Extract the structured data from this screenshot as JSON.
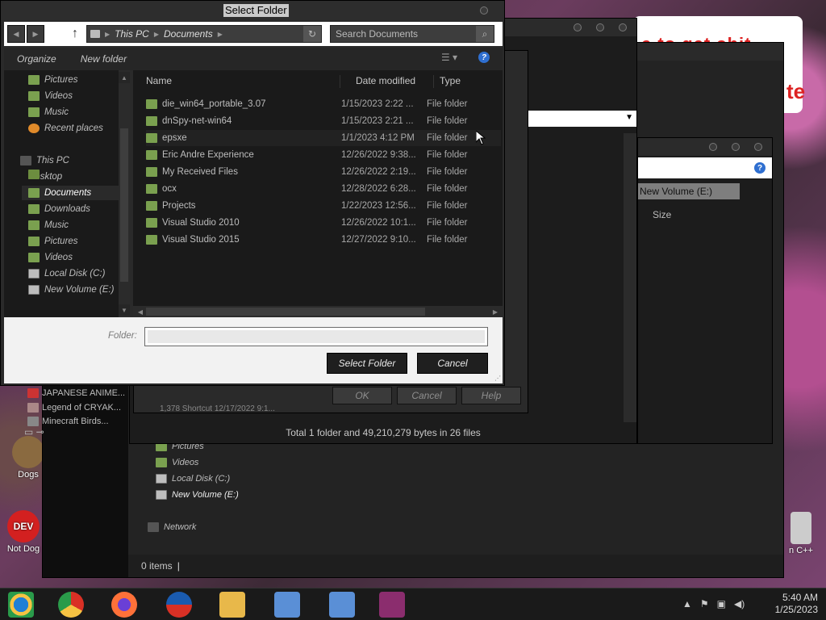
{
  "desktop": {
    "icons": [
      {
        "label": "Dogs"
      },
      {
        "label": "Not Dog"
      },
      {
        "label": "n C++"
      }
    ],
    "red_text_1": "e to get shit",
    "red_text_2": "te"
  },
  "back_window": {
    "nav_items": [
      {
        "label": "Pictures",
        "icon": "folder-icon"
      },
      {
        "label": "Videos",
        "icon": "folder-icon"
      },
      {
        "label": "Local Disk (C:)",
        "icon": "drive-icon"
      },
      {
        "label": "New Volume (E:)",
        "icon": "drive-icon"
      },
      {
        "label": "Network",
        "icon": "network-icon"
      }
    ],
    "status": "0 items"
  },
  "mid_window": {
    "status": "Total 1 folder and 49,210,279 bytes in 26 files",
    "left_items": [
      "JAPANESE ANIME...",
      "Legend of CRYAK...",
      "Minecraft Birds..."
    ],
    "row_fragment": "1,378    Shortcut        12/17/2022 9:1..."
  },
  "right_window": {
    "volume": "New Volume (E:)",
    "size_header": "Size"
  },
  "dialog2": {
    "buttons": [
      "OK",
      "Cancel",
      "Help"
    ]
  },
  "select_folder": {
    "title": "Select Folder",
    "breadcrumb": [
      "This PC",
      "Documents"
    ],
    "search_placeholder": "Search Documents",
    "toolbar": {
      "organize": "Organize",
      "new_folder": "New folder"
    },
    "nav": [
      {
        "label": "Pictures",
        "icon": "folder"
      },
      {
        "label": "Videos",
        "icon": "folder"
      },
      {
        "label": "Music",
        "icon": "folder"
      },
      {
        "label": "Recent places",
        "icon": "recent"
      },
      {
        "label": "This PC",
        "icon": "pc"
      },
      {
        "label": "Desktop",
        "icon": "desktop"
      },
      {
        "label": "Documents",
        "icon": "folder",
        "selected": true
      },
      {
        "label": "Downloads",
        "icon": "folder"
      },
      {
        "label": "Music",
        "icon": "folder"
      },
      {
        "label": "Pictures",
        "icon": "folder"
      },
      {
        "label": "Videos",
        "icon": "folder"
      },
      {
        "label": "Local Disk (C:)",
        "icon": "drive"
      },
      {
        "label": "New Volume (E:)",
        "icon": "drive"
      }
    ],
    "columns": {
      "name": "Name",
      "date": "Date modified",
      "type": "Type"
    },
    "files": [
      {
        "name": "die_win64_portable_3.07",
        "date": "1/15/2023 2:22 ...",
        "type": "File folder"
      },
      {
        "name": "dnSpy-net-win64",
        "date": "1/15/2023 2:21 ...",
        "type": "File folder"
      },
      {
        "name": "epsxe",
        "date": "1/1/2023 4:12 PM",
        "type": "File folder"
      },
      {
        "name": "Eric Andre Experience",
        "date": "12/26/2022 9:38...",
        "type": "File folder"
      },
      {
        "name": "My Received Files",
        "date": "12/26/2022 2:19...",
        "type": "File folder"
      },
      {
        "name": "ocx",
        "date": "12/28/2022 6:28...",
        "type": "File folder"
      },
      {
        "name": "Projects",
        "date": "1/22/2023 12:56...",
        "type": "File folder"
      },
      {
        "name": "Visual Studio 2010",
        "date": "12/26/2022 10:1...",
        "type": "File folder"
      },
      {
        "name": "Visual Studio 2015",
        "date": "12/27/2022 9:10...",
        "type": "File folder"
      }
    ],
    "folder_label": "Folder:",
    "folder_value": "",
    "select_button": "Select Folder",
    "cancel_button": "Cancel"
  },
  "taskbar": {
    "apps": [
      {
        "name": "chrome-canary-icon",
        "color": "#1f7fd6"
      },
      {
        "name": "chrome-icon",
        "color": "#d93025"
      },
      {
        "name": "firefox-icon",
        "color": "#ff7139"
      },
      {
        "name": "obama-logo-icon",
        "color": "#1a5bb0"
      },
      {
        "name": "file-explorer-icon",
        "color": "#e8b84a"
      },
      {
        "name": "network-setup-icon",
        "color": "#5a8fd6"
      },
      {
        "name": "network-setup-icon-2",
        "color": "#5a8fd6"
      },
      {
        "name": "winrar-icon",
        "color": "#8b2d6e"
      }
    ],
    "time": "5:40 AM",
    "date": "1/25/2023"
  }
}
